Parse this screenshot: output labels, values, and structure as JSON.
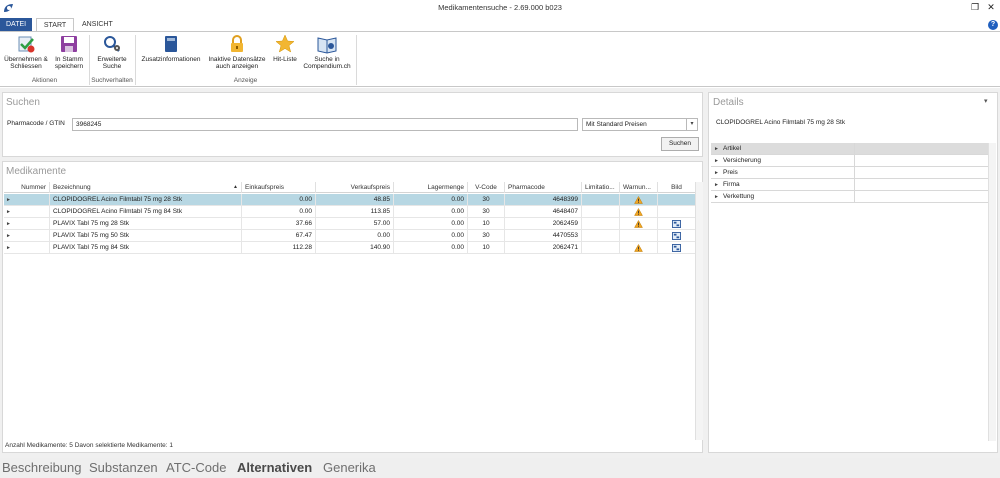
{
  "window": {
    "title": "Medikamentensuche - 2.69.000 b023",
    "restore_glyph": "❐",
    "close_glyph": "✕"
  },
  "tabs": {
    "datei": "DATEI",
    "start": "START",
    "ansicht": "ANSICHT",
    "help": "?"
  },
  "ribbon": {
    "uebernehmen": [
      "Übernehmen &",
      "Schliessen"
    ],
    "in_stamm": [
      "In Stamm",
      "speichern"
    ],
    "aktionen": "Aktionen",
    "erweiterte": [
      "Erweiterte",
      "Suche"
    ],
    "suchverhalten": "Suchverhalten",
    "zusatz": "Zusatzinformationen",
    "inaktive": [
      "Inaktive Datensätze",
      "auch anzeigen"
    ],
    "hitliste": "Hit-Liste",
    "compendium": [
      "Suche in",
      "Compendium.ch"
    ],
    "anzeige": "Anzeige"
  },
  "suchen": {
    "title": "Suchen",
    "label": "Pharmacode / GTIN",
    "value": "3968245",
    "select_value": "Mit Standard Preisen",
    "button": "Suchen"
  },
  "medikamente": {
    "title": "Medikamente",
    "columns": [
      "Nummer",
      "Bezeichnung",
      "Einkaufspreis",
      "Verkaufspreis",
      "Lagermenge",
      "V-Code",
      "Pharmacode",
      "Limitatio...",
      "Warnun...",
      "Bild"
    ],
    "sort_glyph": "▲",
    "expander_glyph": "►",
    "rows": [
      {
        "nummer": "",
        "bezeichnung": "CLOPIDOGREL Acino Filmtabl 75 mg 28 Stk",
        "einkauf": "0.00",
        "verkauf": "48.85",
        "lager": "0.00",
        "vcode": "30",
        "pharmacode": "4648399",
        "warn": true,
        "bild": false,
        "selected": true
      },
      {
        "nummer": "",
        "bezeichnung": "CLOPIDOGREL Acino Filmtabl 75 mg 84 Stk",
        "einkauf": "0.00",
        "verkauf": "113.85",
        "lager": "0.00",
        "vcode": "30",
        "pharmacode": "4648407",
        "warn": true,
        "bild": false,
        "selected": false
      },
      {
        "nummer": "",
        "bezeichnung": "PLAVIX Tabl 75 mg 28 Stk",
        "einkauf": "37.66",
        "verkauf": "57.00",
        "lager": "0.00",
        "vcode": "10",
        "pharmacode": "2062459",
        "warn": true,
        "bild": true,
        "selected": false
      },
      {
        "nummer": "",
        "bezeichnung": "PLAVIX Tabl 75 mg 50 Stk",
        "einkauf": "67.47",
        "verkauf": "0.00",
        "lager": "0.00",
        "vcode": "30",
        "pharmacode": "4470553",
        "warn": false,
        "bild": true,
        "selected": false
      },
      {
        "nummer": "",
        "bezeichnung": "PLAVIX Tabl 75 mg 84 Stk",
        "einkauf": "112.28",
        "verkauf": "140.90",
        "lager": "0.00",
        "vcode": "10",
        "pharmacode": "2062471",
        "warn": true,
        "bild": true,
        "selected": false
      }
    ],
    "status": "Anzahl Medikamente: 5  Davon selektierte Medikamente: 1"
  },
  "details": {
    "title": "Details",
    "pin_glyph": "📌",
    "name": "CLOPIDOGREL Acino Filmtabl 75 mg 28 Stk",
    "rows": [
      "Artikel",
      "Versicherung",
      "Preis",
      "Firma",
      "Verkettung"
    ]
  },
  "bottom_tabs": {
    "beschreibung": "Beschreibung",
    "substanzen": "Substanzen",
    "atc": "ATC-Code",
    "alternativen": "Alternativen",
    "generika": "Generika"
  }
}
